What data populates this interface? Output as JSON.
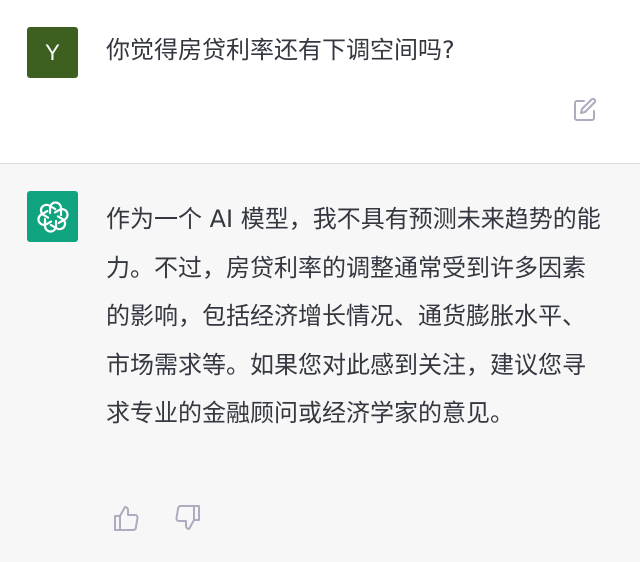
{
  "user_message": {
    "avatar_letter": "Y",
    "avatar_color": "#3d5f1f",
    "text": "你觉得房贷利率还有下调空间吗?",
    "edit_icon": "edit-icon"
  },
  "assistant_message": {
    "avatar_icon": "openai-logo-icon",
    "avatar_color": "#10a37f",
    "text": "作为一个 AI 模型，我不具有预测未来趋势的能力。不过，房贷利率的调整通常受到许多因素的影响，包括经济增长情况、通货膨胀水平、市场需求等。如果您对此感到关注，建议您寻求专业的金融顾问或经济学家的意见。",
    "actions": [
      "thumbs-up-icon",
      "thumbs-down-icon"
    ]
  }
}
